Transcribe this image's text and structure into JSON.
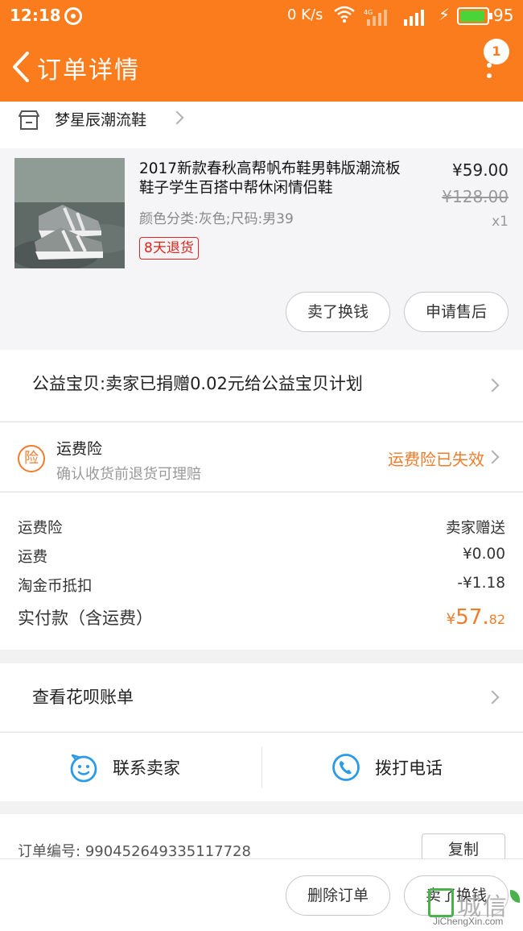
{
  "status_bar": {
    "time": "12:18",
    "network_speed": "0 K/s",
    "signal_tag": "4G",
    "battery_percent": "95",
    "battery_level": 0.95
  },
  "header": {
    "title": "订单详情",
    "notification_count": "1",
    "back_icon": "chevron-left-icon",
    "more_icon": "more-vertical-icon"
  },
  "shop": {
    "name": "梦星辰潮流鞋",
    "icon": "store-icon"
  },
  "product": {
    "title": "2017新款春秋高帮帆布鞋男韩版潮流板鞋子学生百搭中帮休闲情侣鞋",
    "attributes": "颜色分类:灰色;尺码:男39",
    "tag": "8天退货",
    "price": "¥59.00",
    "original_price": "¥128.00",
    "quantity": "x1",
    "actions": [
      "卖了换钱",
      "申请售后"
    ]
  },
  "charity": {
    "text": "公益宝贝:卖家已捐赠0.02元给公益宝贝计划"
  },
  "insurance": {
    "icon_char": "险",
    "title": "运费险",
    "subtitle": "确认收货前退货可理赔",
    "status": "运费险已失效",
    "accent_color": "#f07c2d"
  },
  "summary": {
    "rows": [
      {
        "label": "运费险",
        "value": "卖家赠送"
      },
      {
        "label": "运费",
        "value": "¥0.00"
      },
      {
        "label": "淘金币抵扣",
        "value": "-¥1.18"
      }
    ],
    "total_label": "实付款（含运费）",
    "total_currency": "¥",
    "total_major": "57.",
    "total_minor": "82"
  },
  "huabei": {
    "text": "查看花呗账单"
  },
  "contact": {
    "seller_label": "联系卖家",
    "seller_icon": "chat-face-icon",
    "call_label": "拨打电话",
    "call_icon": "phone-icon"
  },
  "order": {
    "number_label": "订单编号:",
    "number": "990452649335117728",
    "copy_label": "复制"
  },
  "bottom_bar": {
    "delete_label": "删除订单",
    "sell_label": "卖了换钱"
  },
  "watermark": {
    "text": "城信",
    "url": "JiChengXin.com"
  },
  "colors": {
    "brand": "#fb7c1c",
    "accent": "#f07c2d",
    "tag_red": "#e2231a"
  }
}
